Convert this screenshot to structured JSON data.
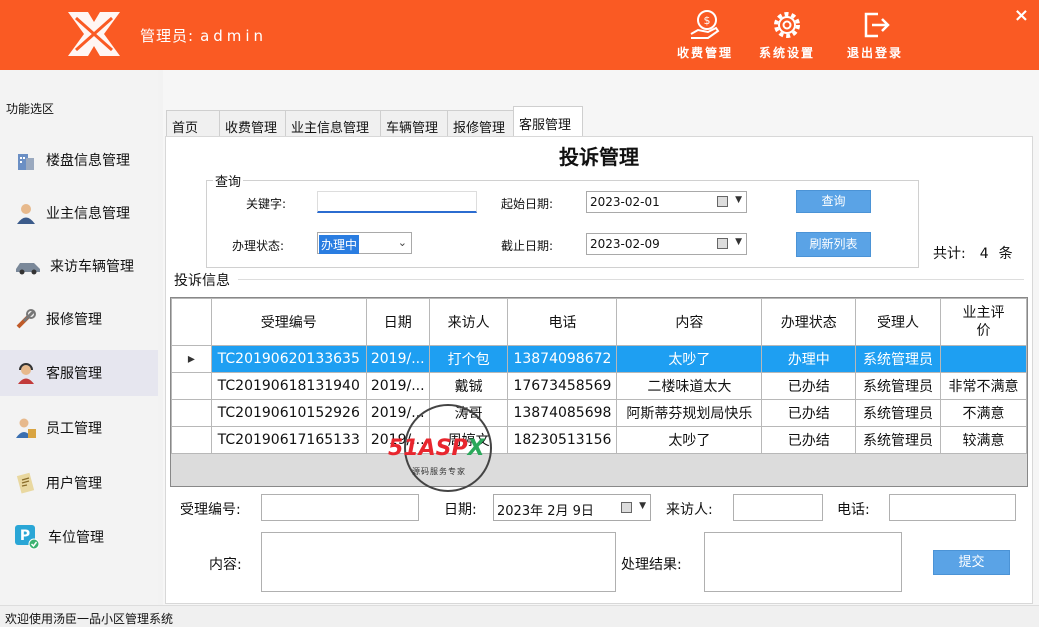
{
  "header": {
    "admin_label": "管理员:",
    "admin_name": "admin",
    "buttons": [
      "收费管理",
      "系统设置",
      "退出登录"
    ],
    "close_glyph": "×"
  },
  "sidebar": {
    "title": "功能选区",
    "items": [
      "楼盘信息管理",
      "业主信息管理",
      "来访车辆管理",
      "报修管理",
      "客服管理",
      "员工管理",
      "用户管理",
      "车位管理"
    ]
  },
  "tabs": [
    "首页",
    "收费管理",
    "业主信息管理",
    "车辆管理",
    "报修管理",
    "客服管理"
  ],
  "panel_title": "投诉管理",
  "query": {
    "legend": "查询",
    "keyword_label": "关键字:",
    "keyword_value": "",
    "status_label": "办理状态:",
    "status_value": "办理中",
    "start_label": "起始日期:",
    "start_value": "2023-02-01",
    "end_label": "截止日期:",
    "end_value": "2023-02-09",
    "search_btn": "查询",
    "refresh_btn": "刷新列表",
    "count_label": "共计:",
    "count_value": "4",
    "count_unit": "条"
  },
  "section_label": "投诉信息",
  "table": {
    "headers": [
      "受理编号",
      "日期",
      "来访人",
      "电话",
      "内容",
      "办理状态",
      "受理人",
      "业主评价"
    ],
    "header_last_line1": "业主评",
    "header_last_line2": "价",
    "rows": [
      [
        "TC20190620133635",
        "2019/...",
        "打个包",
        "13874098672",
        "太吵了",
        "办理中",
        "系统管理员",
        ""
      ],
      [
        "TC20190618131940",
        "2019/...",
        "戴铖",
        "17673458569",
        "二楼味道太大",
        "已办结",
        "系统管理员",
        "非常不满意"
      ],
      [
        "TC20190610152926",
        "2019/...",
        "涛哥",
        "13874085698",
        "阿斯蒂芬规划局快乐",
        "已办结",
        "系统管理员",
        "不满意"
      ],
      [
        "TC20190617165133",
        "2019/...",
        "周婷文",
        "18230513156",
        "太吵了",
        "已办结",
        "系统管理员",
        "较满意"
      ]
    ]
  },
  "form": {
    "id_label": "受理编号:",
    "date_label": "日期:",
    "date_value": "2023年  2月  9日",
    "visitor_label": "来访人:",
    "phone_label": "电话:",
    "content_label": "内容:",
    "result_label": "处理结果:",
    "submit_btn": "提交"
  },
  "statusbar": "欢迎使用汤臣一品小区管理系统",
  "watermark": {
    "text_a": "51ASP",
    "text_b": "X",
    "sub": "源码服务专家"
  },
  "colors": {
    "header": "#fa5a23",
    "button": "#5aa3e6",
    "selected_row": "#1e9ff2"
  }
}
